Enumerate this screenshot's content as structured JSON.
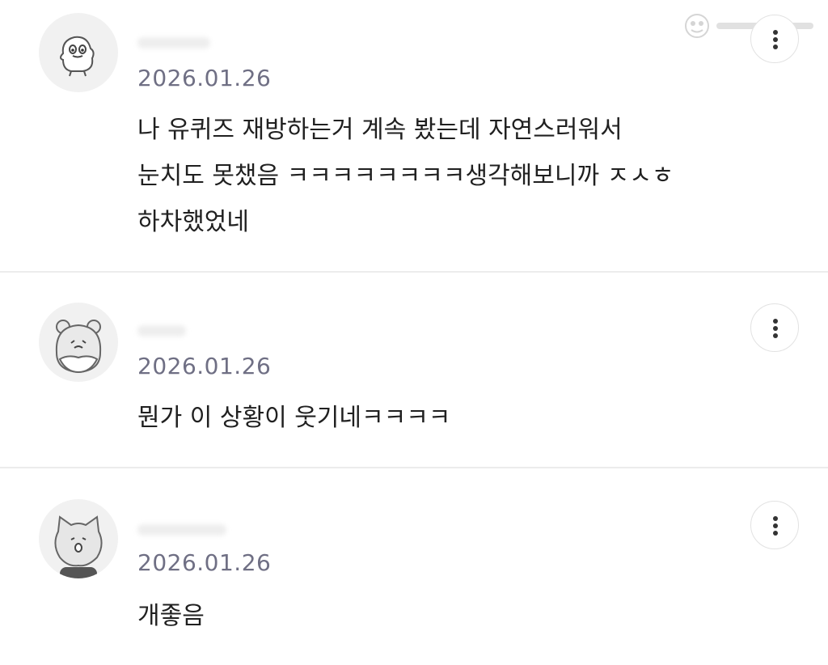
{
  "comments": [
    {
      "date": "2026.01.26",
      "lines": [
        "나 유퀴즈 재방하는거 계속 봤는데 자연스러워서",
        "눈치도 못챘음 ㅋㅋㅋㅋㅋㅋㅋㅋ생각해보니까 ㅈㅅㅎ",
        "하차했었네"
      ],
      "avatar_icon": "duck-avatar-icon",
      "menu_icon": "more-vertical-icon"
    },
    {
      "date": "2026.01.26",
      "lines": [
        "뭔가 이 상황이 웃기네ㅋㅋㅋㅋ"
      ],
      "avatar_icon": "bear-avatar-icon",
      "menu_icon": "more-vertical-icon"
    },
    {
      "date": "2026.01.26",
      "lines": [
        "개좋음"
      ],
      "avatar_icon": "cat-avatar-icon",
      "menu_icon": "more-vertical-icon"
    }
  ],
  "colors": {
    "date": "#6f6f84",
    "text": "#202020",
    "divider": "#ececec",
    "avatar_bg": "#f1f1f1"
  }
}
